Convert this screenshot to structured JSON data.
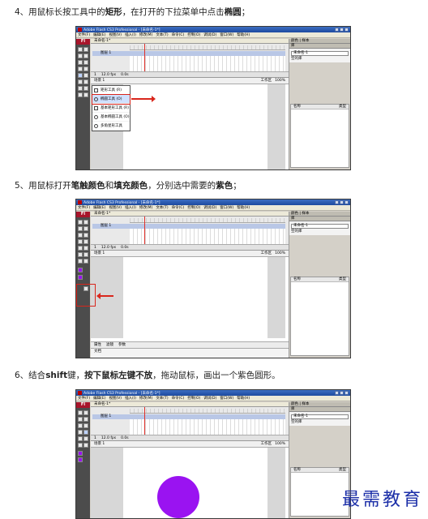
{
  "steps": [
    {
      "prefix": "4、用鼠标长按工具中的",
      "bold1": "矩形",
      "mid": "，在打开的下拉菜单中点击",
      "bold2": "椭圆",
      "suffix": "；"
    },
    {
      "prefix": "5、用鼠标打开",
      "bold1": "笔触颜色",
      "mid": "和",
      "bold2": "填充颜色",
      "suffix": "，分别选中需要的",
      "bold3": "紫色",
      "end": "；"
    },
    {
      "prefix": "6、结合",
      "bold1": "shift",
      "mid": "键，",
      "bold2": "按下鼠标左键不放",
      "suffix": "，拖动鼠标，画出一个紫色圆形。"
    }
  ],
  "app": {
    "title": "Adobe Flash CS3 Professional - [未命名-1*]",
    "logo": "Fl",
    "menus": [
      "文件(F)",
      "编辑(E)",
      "视图(V)",
      "插入(I)",
      "修改(M)",
      "文本(T)",
      "命令(C)",
      "控制(O)",
      "调试(D)",
      "窗口(W)",
      "帮助(H)"
    ],
    "doc_tab": "未命名-1*",
    "layer_name": "图层 1",
    "scene": "场景 1",
    "frame": "1",
    "fps": "12.0 fps",
    "time": "0.0s",
    "workspace": "工作区",
    "zoom": "100%",
    "panel_tabs": [
      "颜色",
      "样本"
    ],
    "library_tab": "库",
    "library_doc": "未命名-1",
    "library_empty": "空的库",
    "lib_col_name": "名称",
    "lib_col_type": "类型",
    "props_tabs": [
      "属性",
      "滤镜",
      "参数"
    ],
    "props_label": "文档"
  },
  "tool_menu": [
    {
      "label": "矩形工具 (R)",
      "selected": false
    },
    {
      "label": "椭圆工具 (O)",
      "selected": true
    },
    {
      "label": "基本矩形工具 (R)",
      "selected": false
    },
    {
      "label": "基本椭圆工具 (O)",
      "selected": false
    },
    {
      "label": "多角星形工具",
      "selected": false
    }
  ],
  "colors": {
    "accent_red": "#d9261c",
    "purple": "#9a13f1",
    "title_blue": "#1d4aa0"
  },
  "watermark": "最需教育"
}
